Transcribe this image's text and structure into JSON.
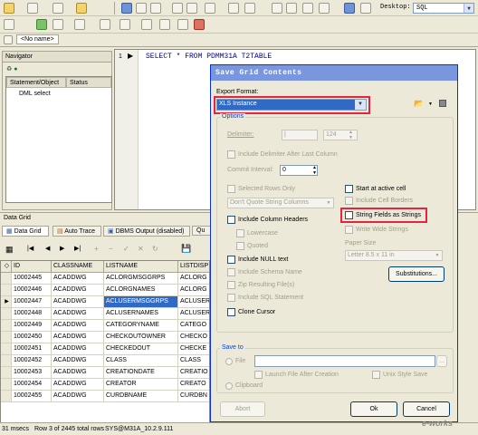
{
  "toolbar": {
    "desktop_label": "Desktop:",
    "desktop_value": "SQL"
  },
  "doc_tab": {
    "label": "<No name>"
  },
  "navigator": {
    "title": "Navigator",
    "columns": [
      "Statement/Object",
      "Status"
    ],
    "items": [
      "DML select"
    ]
  },
  "editor": {
    "line_number": "1",
    "sql": "SELECT * FROM PDMM31A T2TABLE"
  },
  "data_grid": {
    "title": "Data Grid",
    "tabs": [
      "Data Grid",
      "Auto Trace",
      "DBMS Output (disabled)",
      "Qu"
    ],
    "columns": [
      "ID",
      "CLASSNAME",
      "LISTNAME",
      "LISTDISP"
    ],
    "rows": [
      [
        "10002445",
        "ACADDWG",
        "ACLORGMSGGRPS",
        "ACLORG"
      ],
      [
        "10002446",
        "ACADDWG",
        "ACLORGNAMES",
        "ACLORG"
      ],
      [
        "10002447",
        "ACADDWG",
        "ACLUSERMSGGRPS",
        "ACLUSER"
      ],
      [
        "10002448",
        "ACADDWG",
        "ACLUSERNAMES",
        "ACLUSER"
      ],
      [
        "10002449",
        "ACADDWG",
        "CATEGORYNAME",
        "CATEGO"
      ],
      [
        "10002450",
        "ACADDWG",
        "CHECKOUTOWNER",
        "CHECKO"
      ],
      [
        "10002451",
        "ACADDWG",
        "CHECKEDOUT",
        "CHECKE"
      ],
      [
        "10002452",
        "ACADDWG",
        "CLASS",
        "CLASS"
      ],
      [
        "10002453",
        "ACADDWG",
        "CREATIONDATE",
        "CREATIO"
      ],
      [
        "10002454",
        "ACADDWG",
        "CREATOR",
        "CREATO"
      ],
      [
        "10002455",
        "ACADDWG",
        "CURDBNAME",
        "CURDBN"
      ]
    ],
    "selected_row": 2
  },
  "status_bar": {
    "time": "31 msecs",
    "rows": "Row 3 of 2445 total rows",
    "connection": "SYS@M31A_10.2.9.111"
  },
  "dialog": {
    "title": "Save Grid Contents",
    "export_format_label": "Export Format:",
    "export_format_value": "XLS Instance",
    "options_label": "Options",
    "delimiter_label": "Delimiter:",
    "delimiter_value": "|",
    "delimiter_code": "124",
    "include_delimiter_label": "Include Delimiter After Last Column",
    "commit_interval_label": "Commit Interval:",
    "commit_interval_value": "0",
    "selected_rows_label": "Selected Rows Only",
    "quote_strings_value": "Don't Quote String Columns",
    "start_active_label": "Start at active cell",
    "include_cell_borders_label": "Include Cell Borders",
    "string_fields_label": "String Fields as Strings",
    "write_wide_label": "Write Wide Strings",
    "include_col_headers_label": "Include Column Headers",
    "lowercase_label": "Lowercase",
    "quoted_label": "Quoted",
    "paper_size_label": "Paper Size",
    "paper_size_value": "Letter 8.5 x 11 in",
    "include_null_label": "Include NULL text",
    "include_schema_label": "Include Schema Name",
    "zip_label": "Zip Resulting File(s)",
    "substitutions_label": "Substitutions...",
    "include_sql_label": "Include SQL Statement",
    "clone_cursor_label": "Clone Cursor",
    "save_to_label": "Save to",
    "file_label": "File",
    "launch_file_label": "Launch File After Creation",
    "unix_style_label": "Unix Style Save",
    "clipboard_label": "Clipboard",
    "abort_label": "Abort",
    "ok_label": "Ok",
    "cancel_label": "Cancel"
  },
  "watermark": "e-works"
}
